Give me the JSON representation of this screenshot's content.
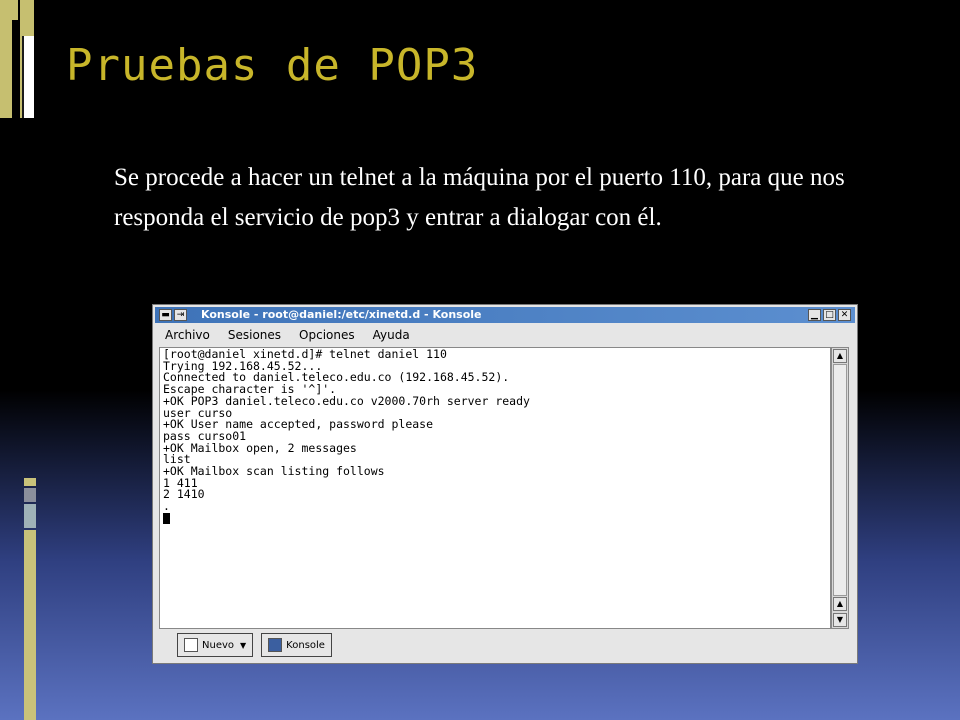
{
  "slide": {
    "title": "Pruebas de POP3",
    "body": "Se procede a hacer un telnet a la máquina por el puerto 110, para que nos responda el servicio de pop3 y entrar a dialogar con él."
  },
  "konsole": {
    "window_title": "Konsole - root@daniel:/etc/xinetd.d - Konsole",
    "titlebar_left_buttons": [
      "▬",
      "⇥"
    ],
    "titlebar_right_buttons": [
      "▁",
      "□",
      "✕"
    ],
    "menu": [
      "Archivo",
      "Sesiones",
      "Opciones",
      "Ayuda"
    ],
    "terminal_lines": [
      "[root@daniel xinetd.d]# telnet daniel 110",
      "Trying 192.168.45.52...",
      "Connected to daniel.teleco.edu.co (192.168.45.52).",
      "Escape character is '^]'.",
      "+OK POP3 daniel.teleco.edu.co v2000.70rh server ready",
      "user curso",
      "+OK User name accepted, password please",
      "pass curso01",
      "+OK Mailbox open, 2 messages",
      "list",
      "+OK Mailbox scan listing follows",
      "1 411",
      "2 1410",
      "."
    ],
    "tabs": [
      "Nuevo",
      "Konsole"
    ],
    "scroll_up_icon": "▲",
    "scroll_down_icon": "▼"
  },
  "colors": {
    "title": "#c8b62a",
    "titlebar": "#3e73b8"
  }
}
